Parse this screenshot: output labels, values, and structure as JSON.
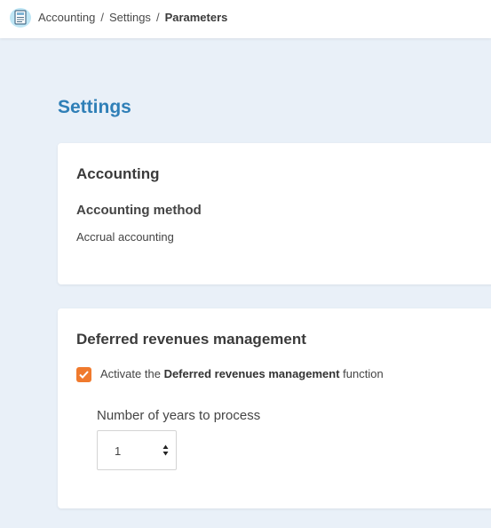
{
  "breadcrumb": {
    "items": [
      "Accounting",
      "Settings"
    ],
    "current": "Parameters",
    "separator": "/"
  },
  "page": {
    "title": "Settings"
  },
  "accounting_card": {
    "title": "Accounting",
    "method_label": "Accounting method",
    "method_value": "Accrual accounting"
  },
  "deferred_card": {
    "title": "Deferred revenues management",
    "checkbox": {
      "checked": true,
      "label_prefix": "Activate the",
      "label_bold": "Deferred revenues management",
      "label_suffix": "function"
    },
    "years_label": "Number of years to process",
    "years_value": "1"
  },
  "colors": {
    "accent_blue": "#2f7fb7",
    "checkbox_orange": "#f07a2d",
    "background": "#e9f0f8"
  },
  "icons": {
    "app": "accounting-document-icon",
    "checkmark": "checkmark-icon",
    "spinner": "up-down-arrows-icon"
  }
}
